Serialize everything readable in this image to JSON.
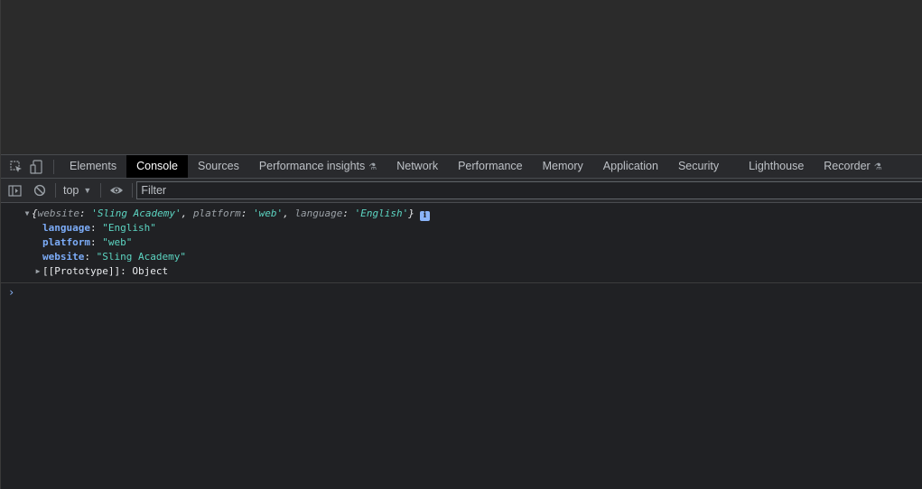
{
  "tabs": [
    {
      "label": "Elements",
      "active": false
    },
    {
      "label": "Console",
      "active": true
    },
    {
      "label": "Sources",
      "active": false
    },
    {
      "label": "Performance insights",
      "active": false,
      "experimental": true
    },
    {
      "label": "Network",
      "active": false
    },
    {
      "label": "Performance",
      "active": false
    },
    {
      "label": "Memory",
      "active": false
    },
    {
      "label": "Application",
      "active": false
    },
    {
      "label": "Security",
      "active": false
    },
    {
      "label": "Lighthouse",
      "active": false
    },
    {
      "label": "Recorder",
      "active": false,
      "experimental": true
    }
  ],
  "icons": {
    "inspect": "inspect-element-icon",
    "device": "device-toolbar-icon",
    "sidebar": "show-sidebar-icon",
    "clear": "clear-console-icon",
    "eye": "live-expression-icon",
    "flask": "experimental-flask-icon",
    "info": "info-icon"
  },
  "flask_glyph": "⚗",
  "console_toolbar": {
    "context": "top",
    "context_caret": "▼",
    "filter_placeholder": "Filter"
  },
  "log": {
    "preview": {
      "open": "{",
      "items": [
        {
          "key": "website",
          "value": "'Sling Academy'"
        },
        {
          "key": "platform",
          "value": "'web'"
        },
        {
          "key": "language",
          "value": "'English'"
        }
      ],
      "close": "}",
      "info_badge": "i"
    },
    "properties": [
      {
        "key": "language",
        "value": "\"English\""
      },
      {
        "key": "platform",
        "value": "\"web\""
      },
      {
        "key": "website",
        "value": "\"Sling Academy\""
      }
    ],
    "prototype": {
      "key": "[[Prototype]]",
      "value": "Object"
    }
  },
  "prompt_glyph": "›",
  "colors": {
    "background": "#202124",
    "page_area": "#2b2b2b",
    "active_tab": "#000000",
    "key": "#7cacf8",
    "string": "#5cd5c2",
    "badge": "#8ab4f8"
  }
}
